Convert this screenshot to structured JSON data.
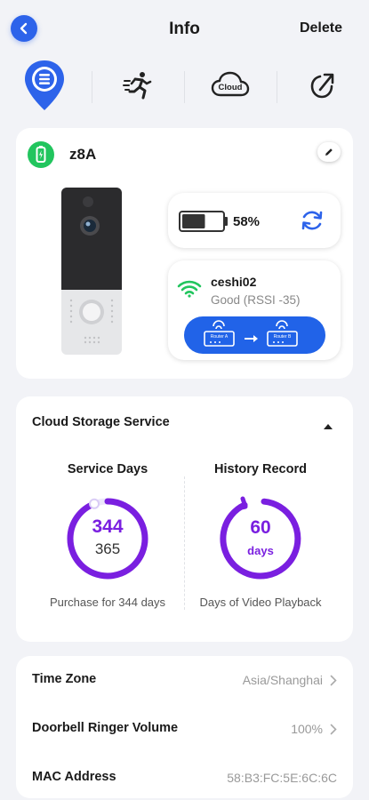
{
  "header": {
    "title": "Info",
    "delete_label": "Delete"
  },
  "tabs": [
    {
      "icon": "device-info-pin-icon",
      "active": true
    },
    {
      "icon": "motion-running-icon",
      "active": false
    },
    {
      "icon": "cloud-icon",
      "label": "Cloud",
      "active": false
    },
    {
      "icon": "share-arrow-icon",
      "active": false
    }
  ],
  "device": {
    "name": "z8A",
    "battery_percent": "58%",
    "battery_level": 0.58,
    "wifi": {
      "ssid": "ceshi02",
      "signal": "Good (RSSI -35)"
    },
    "router_labels": {
      "a": "Router A",
      "b": "Router B"
    }
  },
  "cloud_storage": {
    "title": "Cloud Storage Service",
    "service_days": {
      "heading": "Service Days",
      "remaining": "344",
      "total": "365",
      "caption": "Purchase for 344 days",
      "progress": 0.942
    },
    "history": {
      "heading": "History Record",
      "value": "60",
      "unit": "days",
      "caption": "Days of Video Playback"
    }
  },
  "settings": [
    {
      "label": "Time Zone",
      "value": "Asia/Shanghai",
      "chevron": true
    },
    {
      "label": "Doorbell Ringer Volume",
      "value": "100%",
      "chevron": true
    },
    {
      "label": "MAC Address",
      "value": "58:B3:FC:5E:6C:6C",
      "chevron": false
    }
  ],
  "colors": {
    "accent": "#2d63ea",
    "purple": "#7a1fe0",
    "green": "#22c55e",
    "background": "#f2f3f7"
  }
}
